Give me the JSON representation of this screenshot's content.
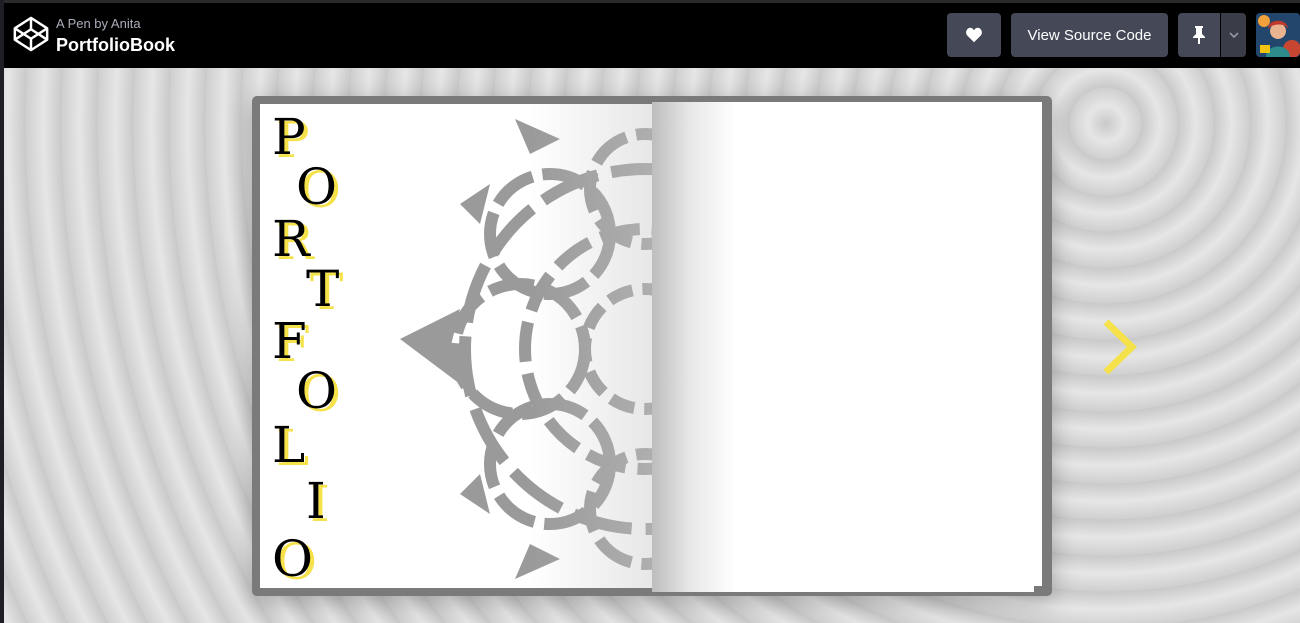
{
  "header": {
    "byline": "A Pen by Anita",
    "title": "PortfolioBook",
    "logo_icon": "codepen-logo-icon",
    "buttons": {
      "heart_icon": "heart-icon",
      "view_source_label": "View Source Code",
      "pin_icon": "pin-icon",
      "caret_icon": "chevron-down-icon"
    },
    "avatar": "user-avatar"
  },
  "book": {
    "cover_letters": [
      "P",
      "O",
      "R",
      "T",
      "F",
      "O",
      "L",
      "I",
      "O"
    ],
    "decoration_icon": "mandala-icon",
    "next_icon": "chevron-right-icon"
  },
  "colors": {
    "topbar": "#000000",
    "button_bg": "#444857",
    "accent_yellow": "#f5e24a",
    "book_frame": "#7a7a7a"
  }
}
